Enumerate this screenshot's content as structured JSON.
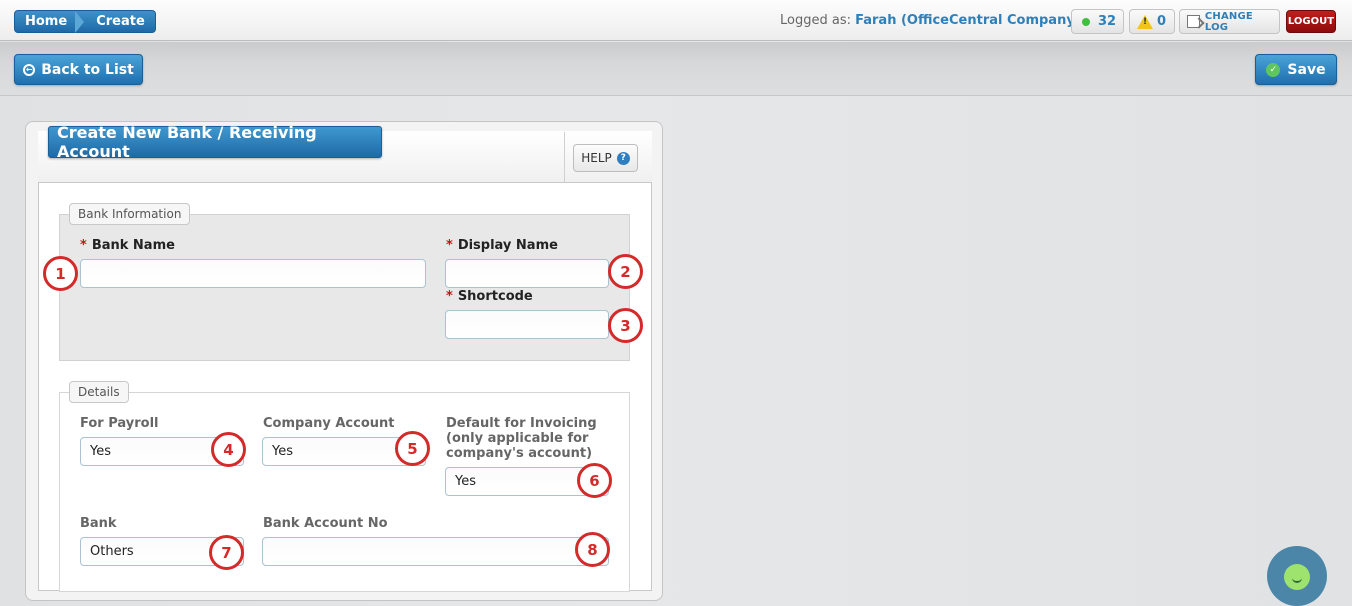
{
  "breadcrumb": {
    "home": "Home",
    "current": "Create"
  },
  "user": {
    "prefix": "Logged as:",
    "name": "Farah (OfficeCentral Company)"
  },
  "notifications": {
    "online_count": "32",
    "warning_count": "0"
  },
  "header_buttons": {
    "changelog": "CHANGE LOG",
    "logout": "LOGOUT"
  },
  "actions": {
    "back": "Back to List",
    "save": "Save"
  },
  "panel": {
    "title": "Create New Bank / Receiving Account",
    "help": "HELP"
  },
  "bank_info": {
    "legend": "Bank Information",
    "bank_name_label": "Bank Name",
    "bank_name_value": "",
    "display_name_label": "Display Name",
    "display_name_value": "",
    "shortcode_label": "Shortcode",
    "shortcode_value": ""
  },
  "details": {
    "legend": "Details",
    "for_payroll_label": "For Payroll",
    "for_payroll_value": "Yes",
    "company_account_label": "Company Account",
    "company_account_value": "Yes",
    "default_invoicing_label_1": "Default for Invoicing",
    "default_invoicing_label_2": "(only applicable for",
    "default_invoicing_label_3": "company's account)",
    "default_invoicing_value": "Yes",
    "bank_label": "Bank",
    "bank_value": "Others",
    "bank_account_no_label": "Bank Account No",
    "bank_account_no_value": ""
  },
  "markers": [
    "1",
    "2",
    "3",
    "4",
    "5",
    "6",
    "7",
    "8"
  ],
  "colors": {
    "primary": "#1f6aa6",
    "marker": "#d42a2a",
    "logout": "#8e0c0c",
    "required": "#c0151b"
  }
}
